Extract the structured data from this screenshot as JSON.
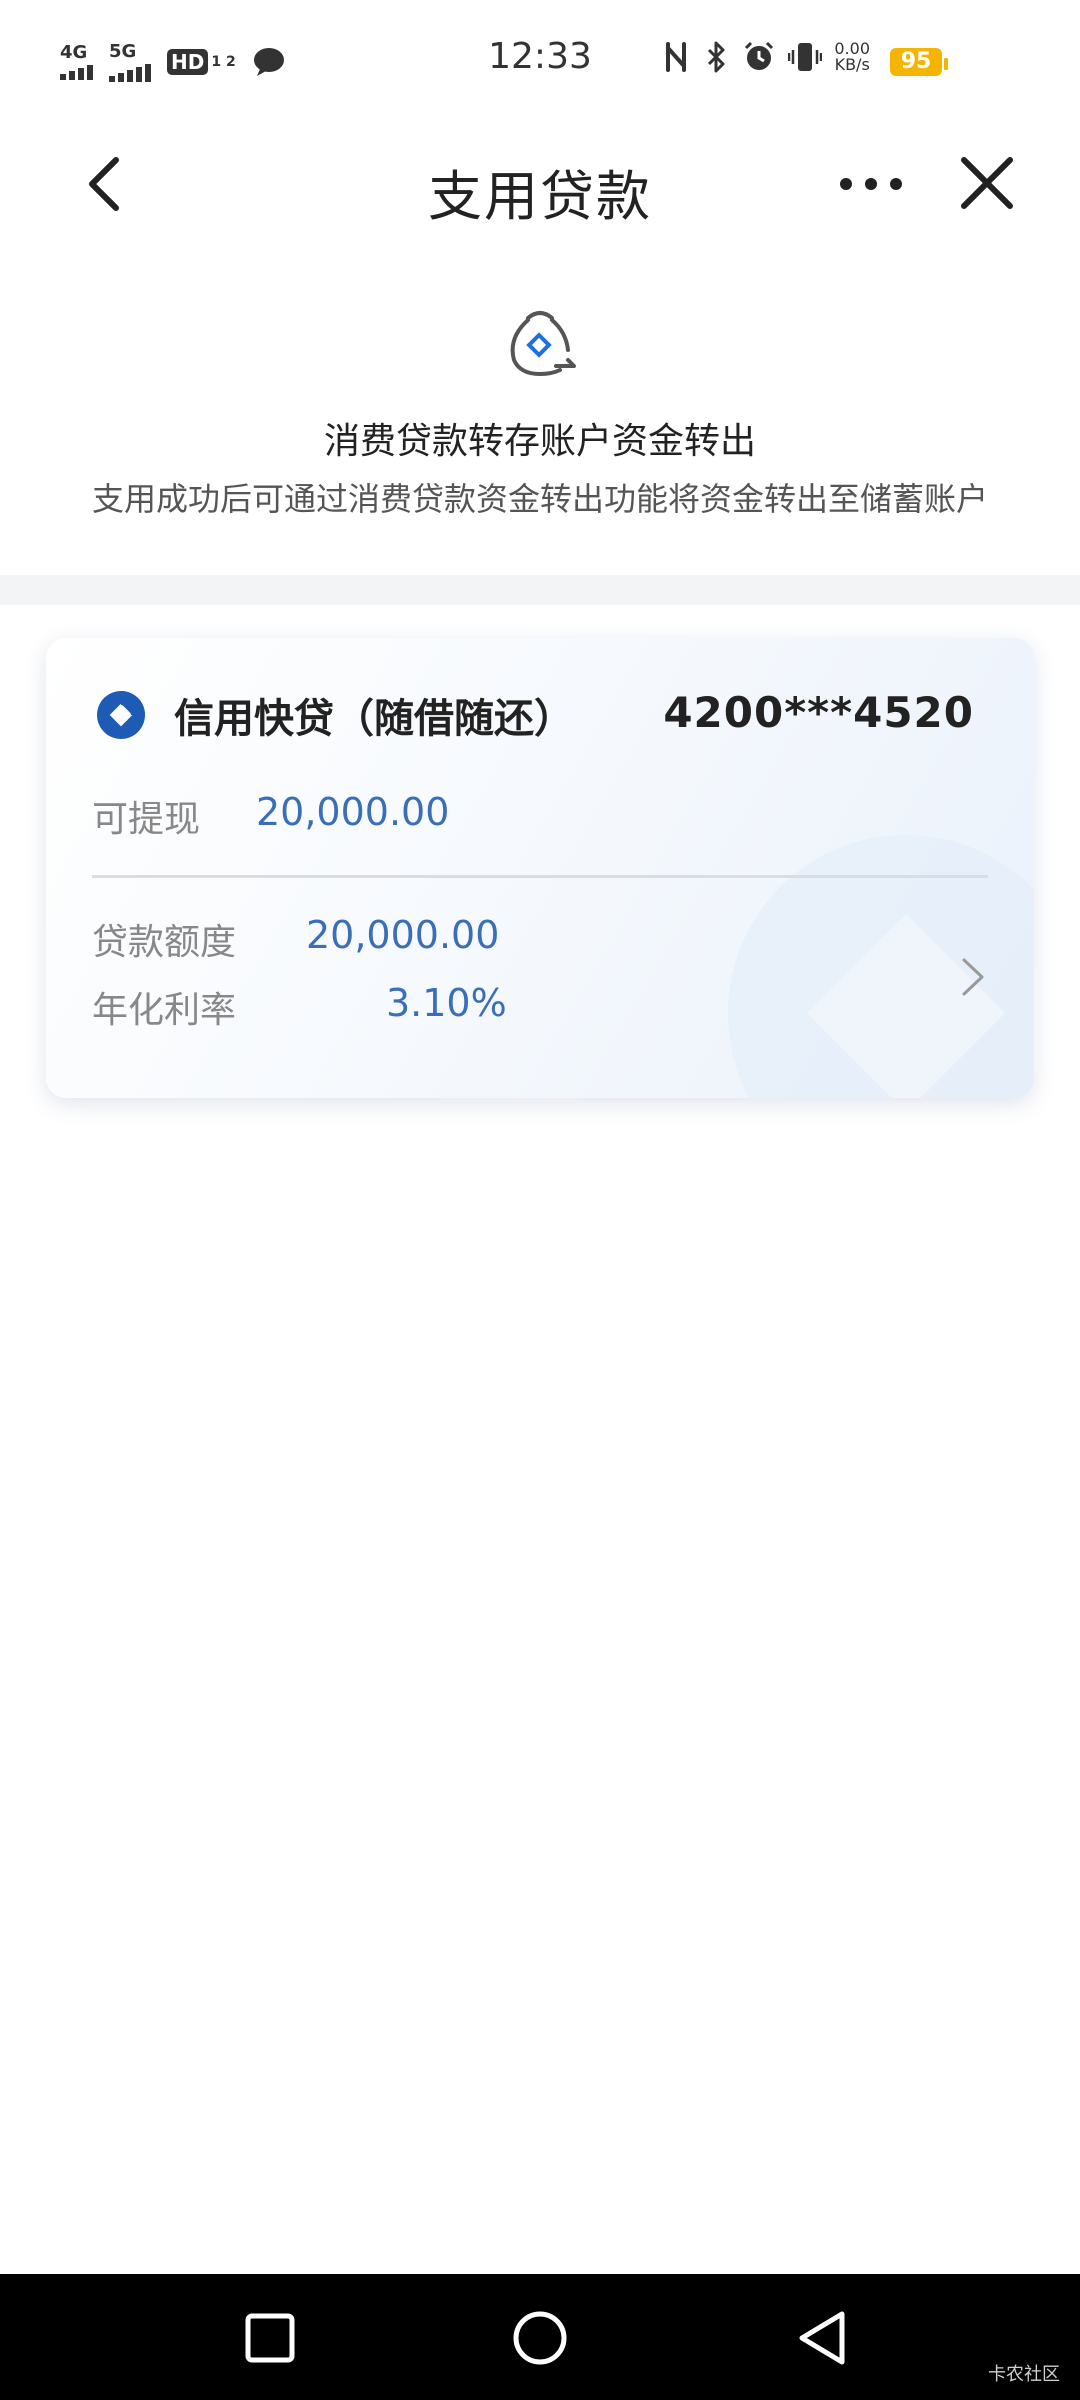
{
  "status_bar": {
    "sim1_label": "4G",
    "sim2_label": "5G",
    "hd_label": "HD",
    "hd_sub": "1 2",
    "time": "12:33",
    "speed_value": "0.00",
    "speed_unit": "KB/s",
    "battery": "95",
    "battery_color": "#f5b400",
    "icons": [
      "signal-icon",
      "signal-icon",
      "hd-icon",
      "message-icon",
      "nfc-icon",
      "bluetooth-icon",
      "alarm-icon",
      "vibrate-icon",
      "battery-icon"
    ]
  },
  "nav": {
    "title": "支用贷款",
    "back_icon": "chevron-left-icon",
    "more_icon": "more-icon",
    "close_icon": "close-icon"
  },
  "info": {
    "icon": "money-bag-icon",
    "title": "消费贷款转存账户资金转出",
    "subtitle": "支用成功后可通过消费贷款资金转出功能将资金转出至储蓄账户"
  },
  "loan_card": {
    "logo_icon": "bank-logo-icon",
    "product_name": "信用快贷（随借随还）",
    "account_number": "4200***4520",
    "available_label": "可提现",
    "available_value": "20,000.00",
    "limit_label": "贷款额度",
    "limit_value": "20,000.00",
    "rate_label": "年化利率",
    "rate_value": "3.10%",
    "accent_color": "#3a6fb8"
  },
  "system_nav": {
    "recent_icon": "square-icon",
    "home_icon": "circle-icon",
    "back_icon": "triangle-back-icon",
    "watermark": "卡农社区"
  }
}
